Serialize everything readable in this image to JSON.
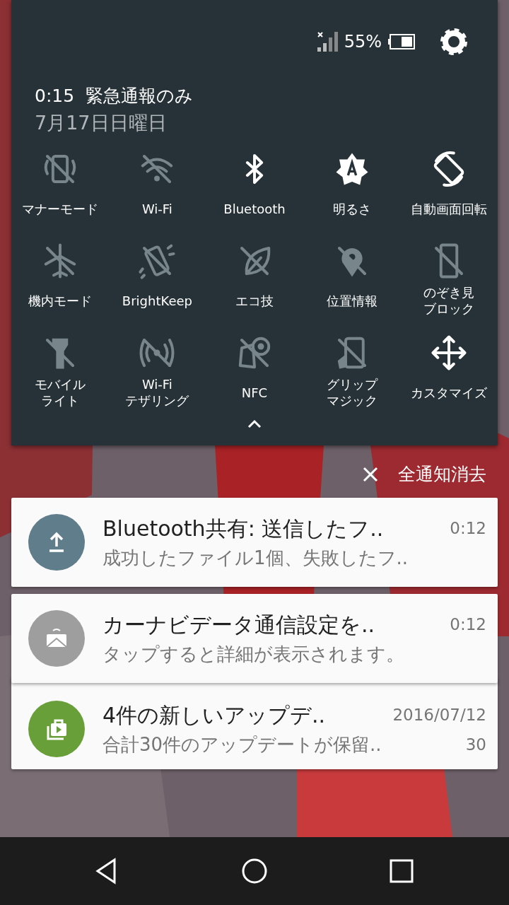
{
  "status_bar": {
    "battery": "55%"
  },
  "header": {
    "time": "0:15",
    "carrier": "緊急通報のみ",
    "date": "7月17日日曜日"
  },
  "tiles": [
    {
      "kind": "manner",
      "label": "マナーモード",
      "on": false
    },
    {
      "kind": "wifi",
      "label": "Wi-Fi",
      "on": false
    },
    {
      "kind": "bluetooth",
      "label": "Bluetooth",
      "on": true
    },
    {
      "kind": "brightness",
      "label": "明るさ",
      "on": true
    },
    {
      "kind": "rotate",
      "label": "自動画面回転",
      "on": true
    },
    {
      "kind": "airplane",
      "label": "機内モード",
      "on": false
    },
    {
      "kind": "brightkeep",
      "label": "BrightKeep",
      "on": false
    },
    {
      "kind": "eco",
      "label": "エコ技",
      "on": false
    },
    {
      "kind": "location",
      "label": "位置情報",
      "on": false
    },
    {
      "kind": "peep",
      "label": "のぞき見",
      "label2": "ブロック",
      "on": false
    },
    {
      "kind": "flashlight",
      "label": "モバイル",
      "label2": "ライト",
      "on": false
    },
    {
      "kind": "hotspot",
      "label": "Wi-Fi",
      "label2": "テザリング",
      "on": false
    },
    {
      "kind": "nfc",
      "label": "NFC",
      "on": false
    },
    {
      "kind": "grip",
      "label": "グリップ",
      "label2": "マジック",
      "on": false
    },
    {
      "kind": "customize",
      "label": "カスタマイズ",
      "on": true
    }
  ],
  "clear_all": {
    "label": "全通知消去"
  },
  "notifications": [
    {
      "kind": "upload",
      "color": "#607d8b",
      "title": "Bluetooth共有: 送信したフ..",
      "time": "0:12",
      "text": "成功したファイル1個、失敗したフ.."
    },
    {
      "kind": "carnav",
      "color": "#9e9e9e",
      "title": "カーナビデータ通信設定を..",
      "time": "0:12",
      "text": "タップすると詳細が表示されます。"
    },
    {
      "kind": "store",
      "color": "#689f38",
      "title": "4件の新しいアップデ..",
      "time": "2016/07/12",
      "text": "合計30件のアップデートが保留..",
      "count": "30"
    }
  ]
}
